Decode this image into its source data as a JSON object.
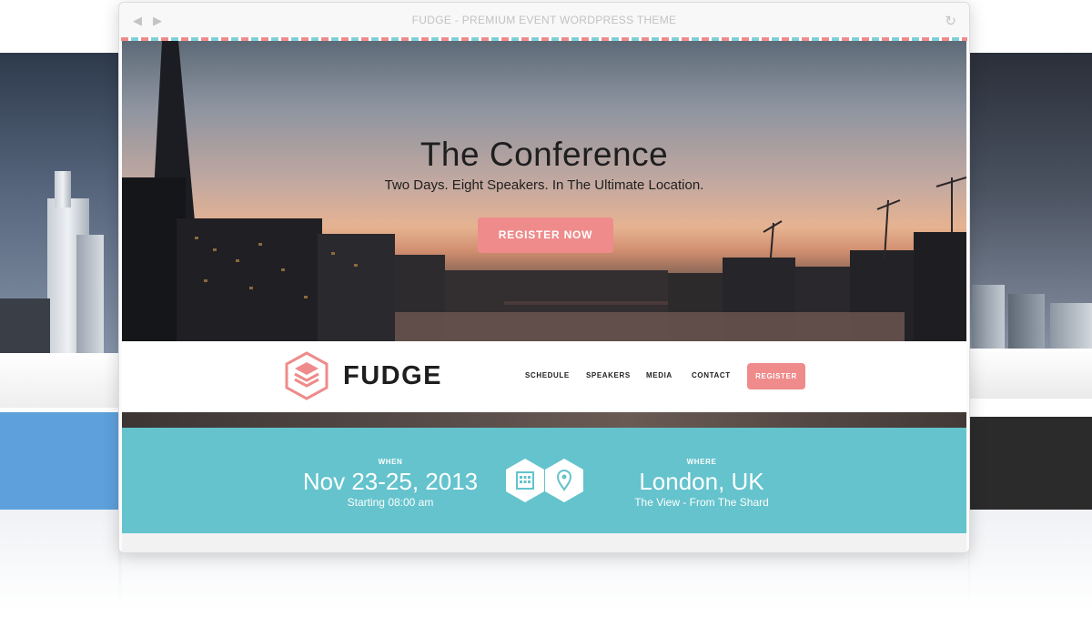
{
  "window": {
    "title": "FUDGE - PREMIUM EVENT WORDPRESS THEME",
    "back_icon": "chevron-left-icon",
    "forward_icon": "chevron-right-icon",
    "refresh_icon": "refresh-icon"
  },
  "hero": {
    "title": "The Conference",
    "subtitle": "Two Days. Eight Speakers. In The Ultimate Location.",
    "cta_label": "REGISTER NOW"
  },
  "header": {
    "brand": "FUDGE",
    "logo_icon": "stacked-hexagon-logo-icon",
    "menu": [
      "SCHEDULE",
      "SPEAKERS",
      "MEDIA",
      "CONTACT"
    ],
    "register_label": "REGISTER"
  },
  "info": {
    "when": {
      "label": "WHEN",
      "value": "Nov 23-25, 2013",
      "detail": "Starting 08:00 am",
      "icon": "calendar-icon"
    },
    "where": {
      "label": "WHERE",
      "value": "London, UK",
      "detail": "The View - From The Shard",
      "icon": "location-pin-icon"
    }
  },
  "colors": {
    "accent": "#ef8b8b",
    "info_band": "#64c3cc",
    "text_dark": "#1e1e1e"
  }
}
